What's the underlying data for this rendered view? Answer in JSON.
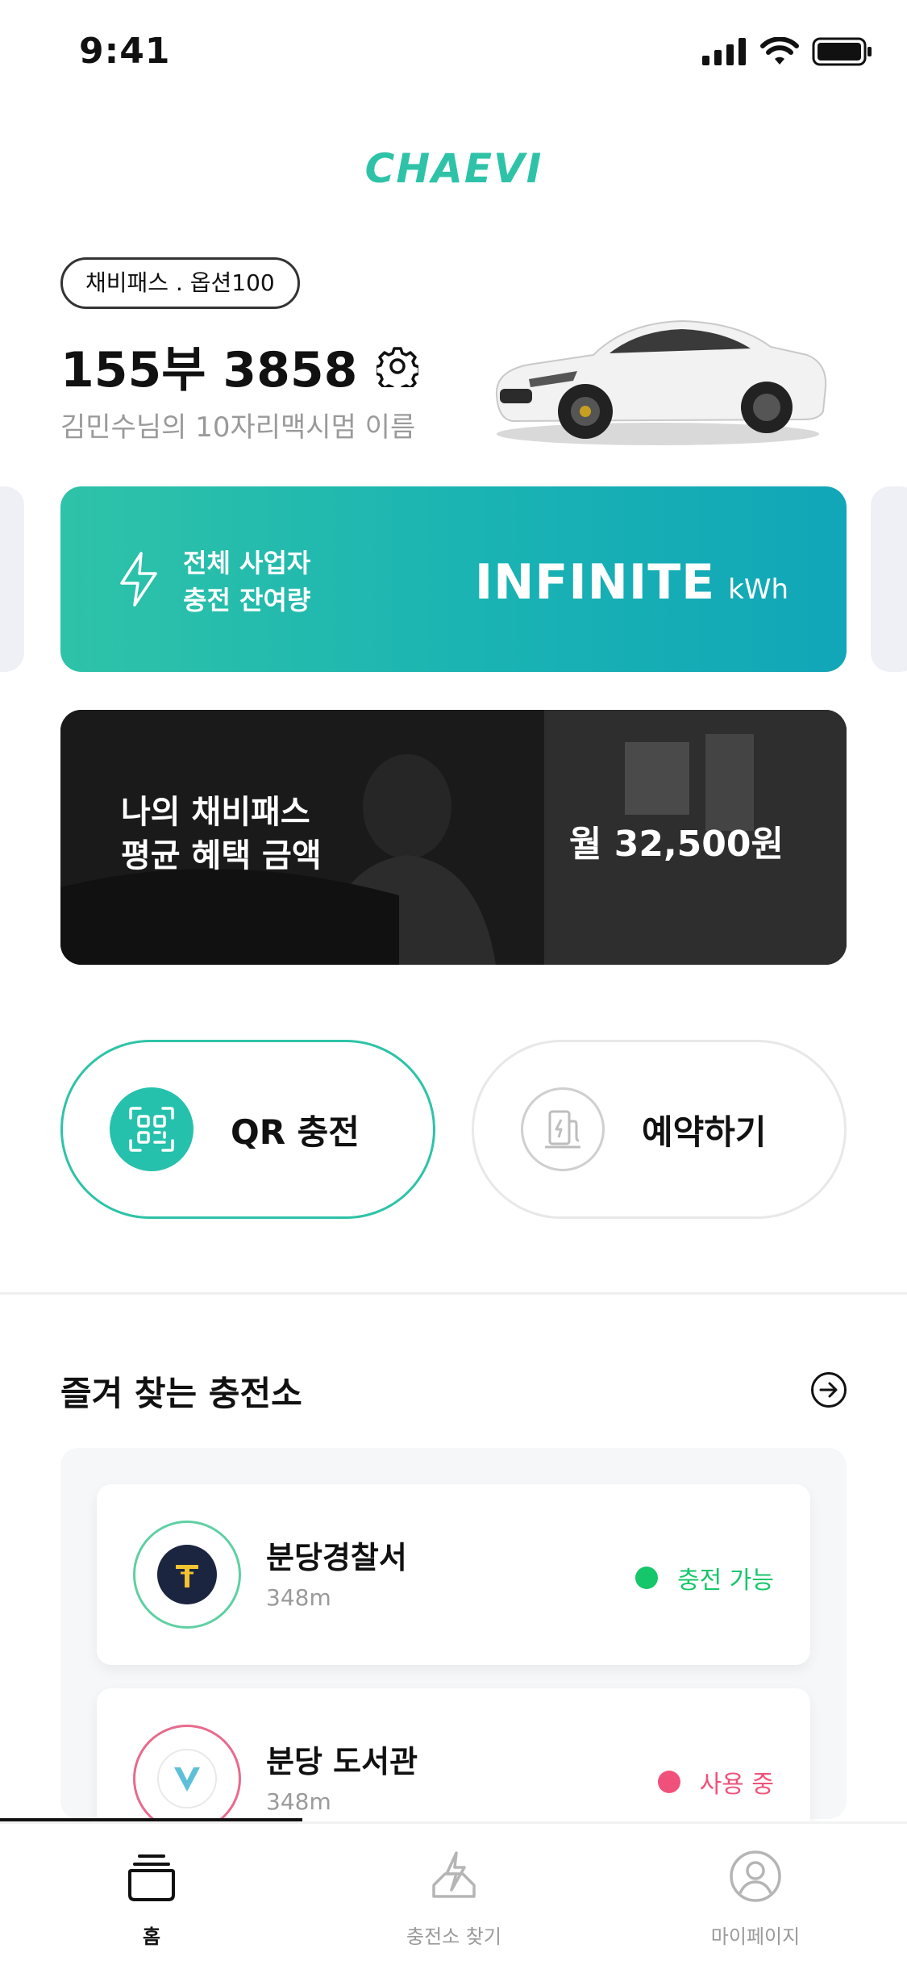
{
  "status_bar": {
    "time": "9:41"
  },
  "brand": {
    "logo_text": "CHAEVI",
    "accent": "#2EC3A8"
  },
  "car": {
    "pass_badge": "채비패스 . 옵션100",
    "plate": "155부 3858",
    "owner_caption": "김민수님의 10자리맥시멈 이름"
  },
  "energy_card": {
    "label_line1": "전체 사업자",
    "label_line2": "충전 잔여량",
    "value": "INFINITE",
    "unit": "kWh"
  },
  "benefit_card": {
    "label_line1": "나의 채비패스",
    "label_line2": "평균 혜택 금액",
    "amount": "월 32,500원"
  },
  "actions": {
    "qr_label": "QR 충전",
    "reserve_label": "예약하기"
  },
  "favorites": {
    "title": "즐겨 찾는 충전소",
    "stations": [
      {
        "name": "분당경찰서",
        "distance": "348m",
        "status": "충전 가능",
        "status_color": "#16C66B"
      },
      {
        "name": "분당 도서관",
        "distance": "348m",
        "status": "사용 중",
        "status_color": "#F0517A"
      }
    ]
  },
  "tabs": [
    {
      "label": "홈",
      "icon": "home-icon"
    },
    {
      "label": "충전소 찾기",
      "icon": "charging-station-icon"
    },
    {
      "label": "마이페이지",
      "icon": "profile-icon"
    }
  ]
}
